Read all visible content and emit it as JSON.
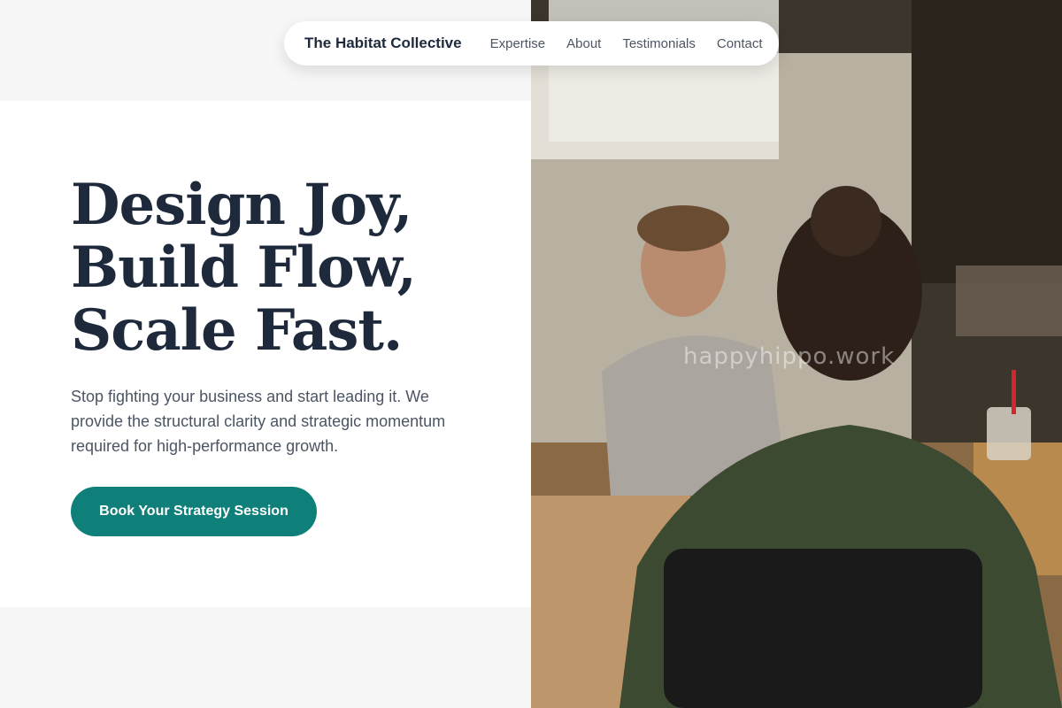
{
  "nav": {
    "brand": "The Habitat Collective",
    "links": [
      "Expertise",
      "About",
      "Testimonials",
      "Contact"
    ]
  },
  "hero": {
    "title_lines": [
      "Design Joy,",
      "Build Flow,",
      "Scale Fast."
    ],
    "subtitle": "Stop fighting your business and start leading it. We provide the structural clarity and strategic momentum required for high-performance growth.",
    "cta_label": "Book Your Strategy Session"
  },
  "photo": {
    "watermark": "happyhippo.work"
  },
  "colors": {
    "heading": "#1e293b",
    "accent": "#0f7f7a",
    "body_text": "#4b5563"
  }
}
